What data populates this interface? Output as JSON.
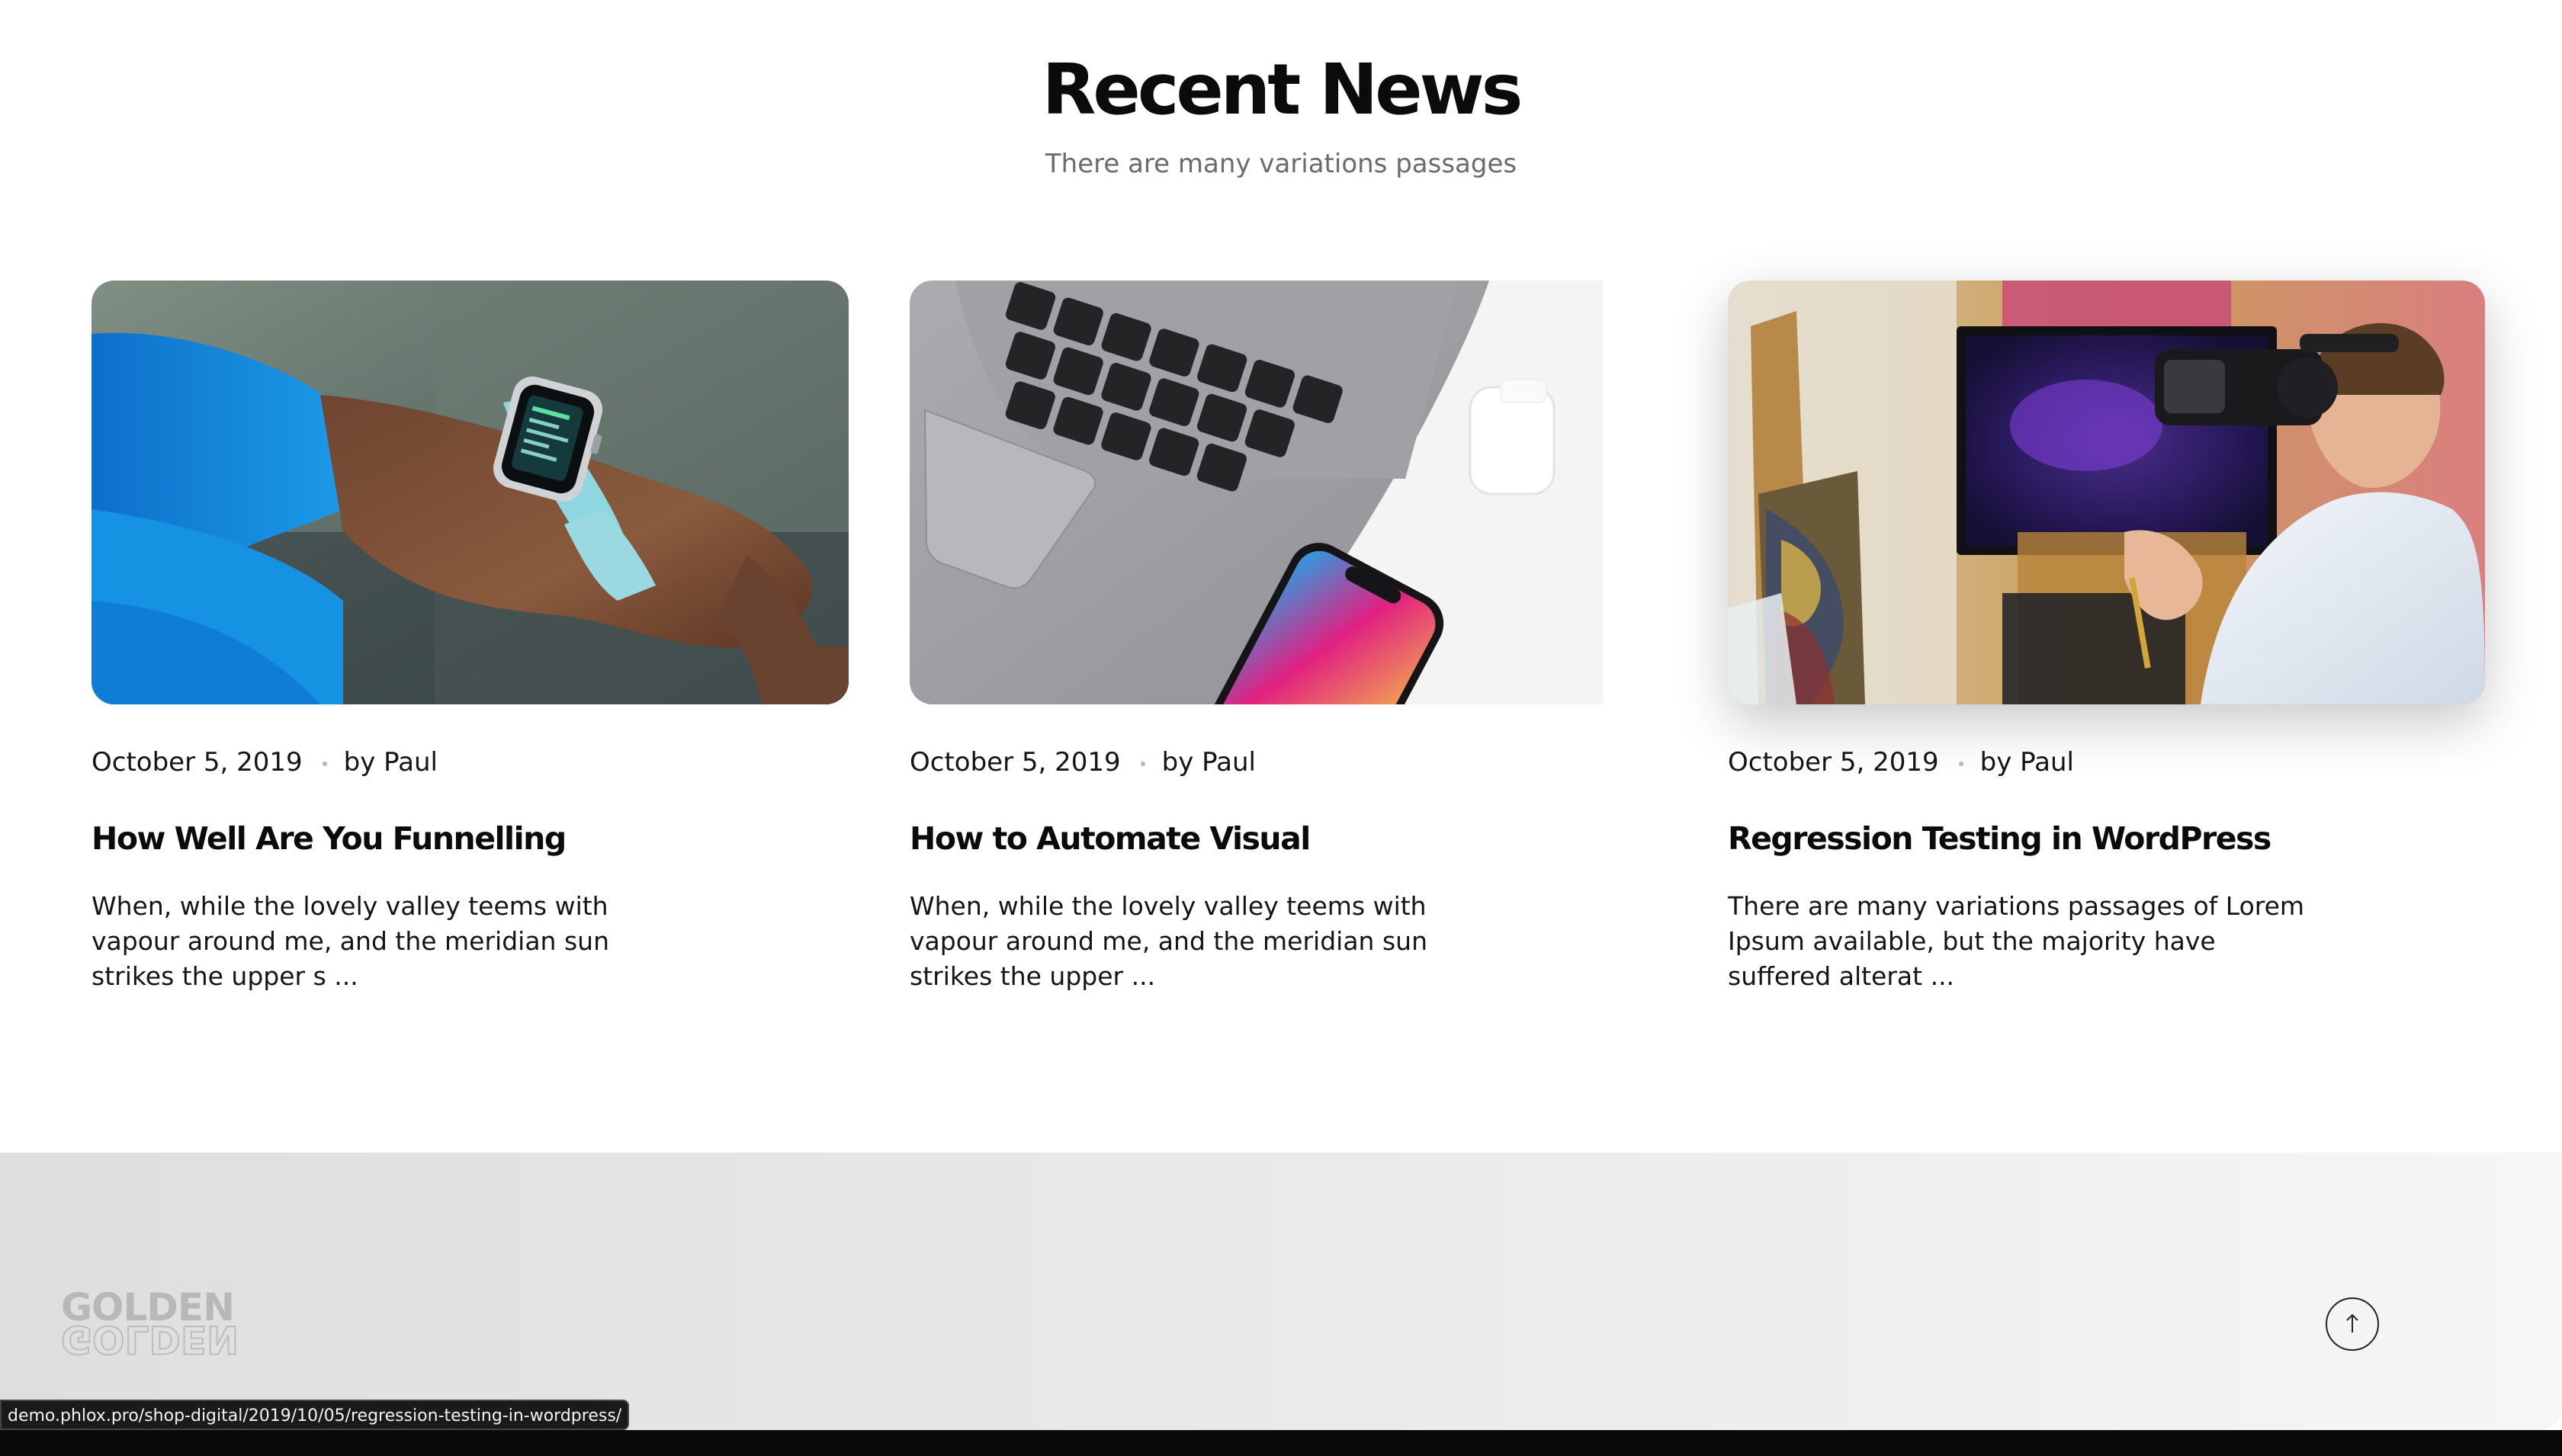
{
  "section": {
    "title": "Recent News",
    "subtitle": "There are many variations passages"
  },
  "posts": [
    {
      "date": "October 5, 2019",
      "author": "by Paul",
      "title": "How Well Are You Funnelling",
      "excerpt": "When, while the lovely valley teems with vapour around me, and the meridian sun strikes the upper s ..."
    },
    {
      "date": "October 5, 2019",
      "author": "by Paul",
      "title": "How to Automate Visual",
      "excerpt": "When, while the lovely valley teems with vapour around me, and the meridian sun strikes the upper ..."
    },
    {
      "date": "October 5, 2019",
      "author": "by Paul",
      "title": "Regression Testing in WordPress",
      "excerpt": "There are many variations passages of Lorem Ipsum available, but the majority have suffered alterat ..."
    }
  ],
  "footer": {
    "logo_text": "GOLDEN",
    "scroll_top_icon": "arrow-up-icon"
  },
  "status_bar": {
    "url": "demo.phlox.pro/shop-digital/2019/10/05/regression-testing-in-wordpress/"
  }
}
